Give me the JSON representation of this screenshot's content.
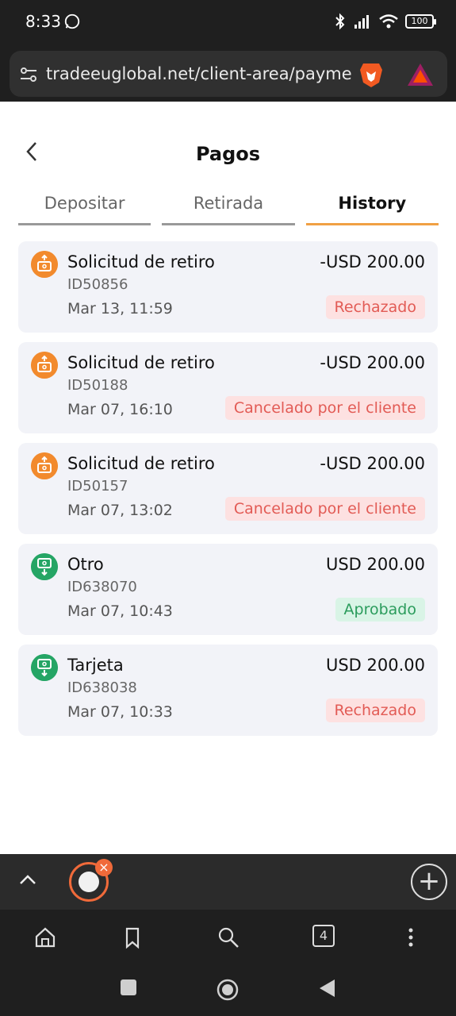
{
  "status_bar": {
    "time": "8:33",
    "battery": "100",
    "icons": [
      "whatsapp-icon",
      "bluetooth-icon",
      "signal-icon",
      "wifi-icon",
      "battery-icon"
    ]
  },
  "browser": {
    "url": "tradeeuglobal.net/client-area/payme",
    "icons": [
      "site-settings-icon",
      "brave-lion-icon",
      "bat-rewards-icon"
    ]
  },
  "page": {
    "title": "Pagos",
    "tabs": [
      {
        "label": "Depositar",
        "active": false
      },
      {
        "label": "Retirada",
        "active": false
      },
      {
        "label": "History",
        "active": true
      }
    ]
  },
  "history": [
    {
      "type": "out",
      "title": "Solicitud de retiro",
      "amount": "-USD 200.00",
      "id": "ID50856",
      "date": "Mar 13, 11:59",
      "status": "Rechazado",
      "status_kind": "rejected"
    },
    {
      "type": "out",
      "title": "Solicitud de retiro",
      "amount": "-USD 200.00",
      "id": "ID50188",
      "date": "Mar 07, 16:10",
      "status": "Cancelado por el cliente",
      "status_kind": "rejected"
    },
    {
      "type": "out",
      "title": "Solicitud de retiro",
      "amount": "-USD 200.00",
      "id": "ID50157",
      "date": "Mar 07, 13:02",
      "status": "Cancelado por el cliente",
      "status_kind": "rejected"
    },
    {
      "type": "in",
      "title": "Otro",
      "amount": "USD 200.00",
      "id": "ID638070",
      "date": "Mar 07, 10:43",
      "status": "Aprobado",
      "status_kind": "approved"
    },
    {
      "type": "in",
      "title": "Tarjeta",
      "amount": "USD 200.00",
      "id": "ID638038",
      "date": "Mar 07, 10:33",
      "status": "Rechazado",
      "status_kind": "rejected"
    }
  ],
  "bottom_bar": {
    "tab_count": "4",
    "icons": [
      "home-icon",
      "bookmark-icon",
      "search-icon",
      "tabs-icon",
      "menu-icon"
    ]
  },
  "colors": {
    "withdraw_icon": "#f28a2d",
    "deposit_icon": "#25a565",
    "active_tab_underline": "#f0a043",
    "rejected_bg": "#fde1e1",
    "approved_bg": "#d9f4e6"
  }
}
